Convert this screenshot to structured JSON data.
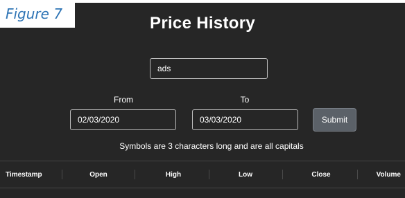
{
  "caption": "Figure 7",
  "title": "Price History",
  "symbol_input": {
    "value": "ads"
  },
  "from": {
    "label": "From",
    "value": "02/03/2020"
  },
  "to": {
    "label": "To",
    "value": "03/03/2020"
  },
  "submit_label": "Submit",
  "hint": "Symbols are 3 characters long and are all capitals",
  "table": {
    "columns": [
      "Timestamp",
      "Open",
      "High",
      "Low",
      "Close",
      "Volume"
    ]
  },
  "colors": {
    "background": "#262626",
    "text": "#ffffff",
    "button": "#5b6168",
    "caption": "#2e74b5"
  }
}
